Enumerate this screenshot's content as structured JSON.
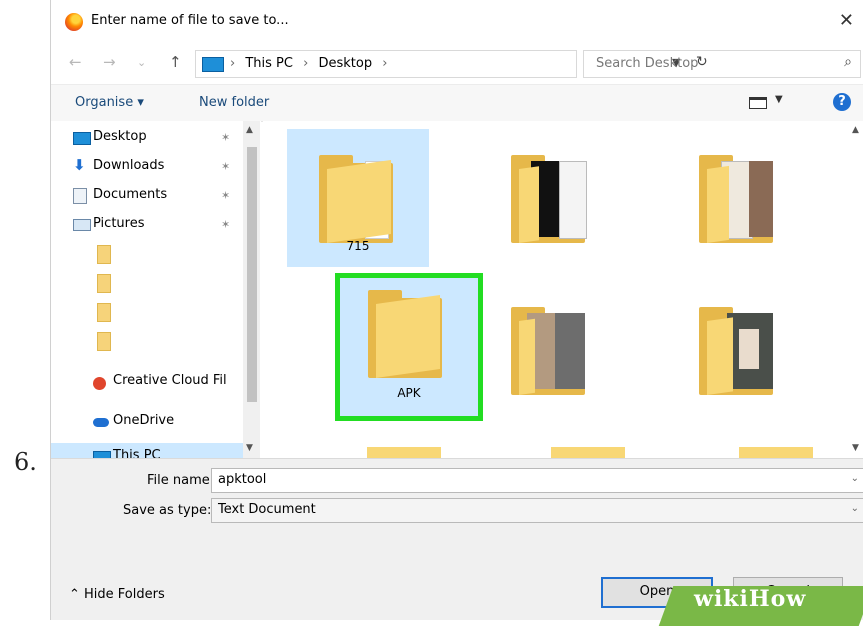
{
  "step_number": "6.",
  "dialog": {
    "title": "Enter name of file to save to...",
    "close_glyph": "✕",
    "nav": {
      "back": "←",
      "forward": "→",
      "recent": "⌄",
      "up": "↑"
    },
    "breadcrumbs": [
      "This PC",
      "Desktop"
    ],
    "crumb_sep": "›",
    "refresh_glyph": "↻",
    "search_placeholder": "Search Desktop",
    "search_glyph": "⌕",
    "toolbar": {
      "organise": "Organise ▾",
      "new_folder": "New folder",
      "help": "?"
    },
    "nav_pane": {
      "quick_access": [
        {
          "label": "Desktop",
          "icon": "desktop-icon"
        },
        {
          "label": "Downloads",
          "icon": "download-arrow-icon"
        },
        {
          "label": "Documents",
          "icon": "documents-icon"
        },
        {
          "label": "Pictures",
          "icon": "pictures-icon"
        }
      ],
      "pin_glyph": "✶",
      "locations": [
        {
          "label": "Creative Cloud Fil",
          "icon": "creative-cloud-icon"
        },
        {
          "label": "OneDrive",
          "icon": "onedrive-cloud-icon"
        },
        {
          "label": "This PC",
          "icon": "computer-icon"
        }
      ]
    },
    "files": [
      {
        "label": "715",
        "selected": true
      },
      {
        "label": "",
        "selected": false
      },
      {
        "label": "",
        "selected": false
      },
      {
        "label": "APK",
        "selected": true,
        "highlighted": true
      },
      {
        "label": "",
        "selected": false
      },
      {
        "label": "",
        "selected": false
      }
    ],
    "file_name_label": "File name:",
    "file_name_value": "apktool",
    "save_type_label": "Save as type:",
    "save_type_value": "Text Document",
    "hide_folders": "⌃  Hide Folders",
    "open_button": "Open",
    "cancel_button": "Cancel"
  },
  "watermark": "wikiHow",
  "colors": {
    "highlight": "#22dd22",
    "selection": "#cce8ff",
    "accent": "#1f6fd1"
  }
}
